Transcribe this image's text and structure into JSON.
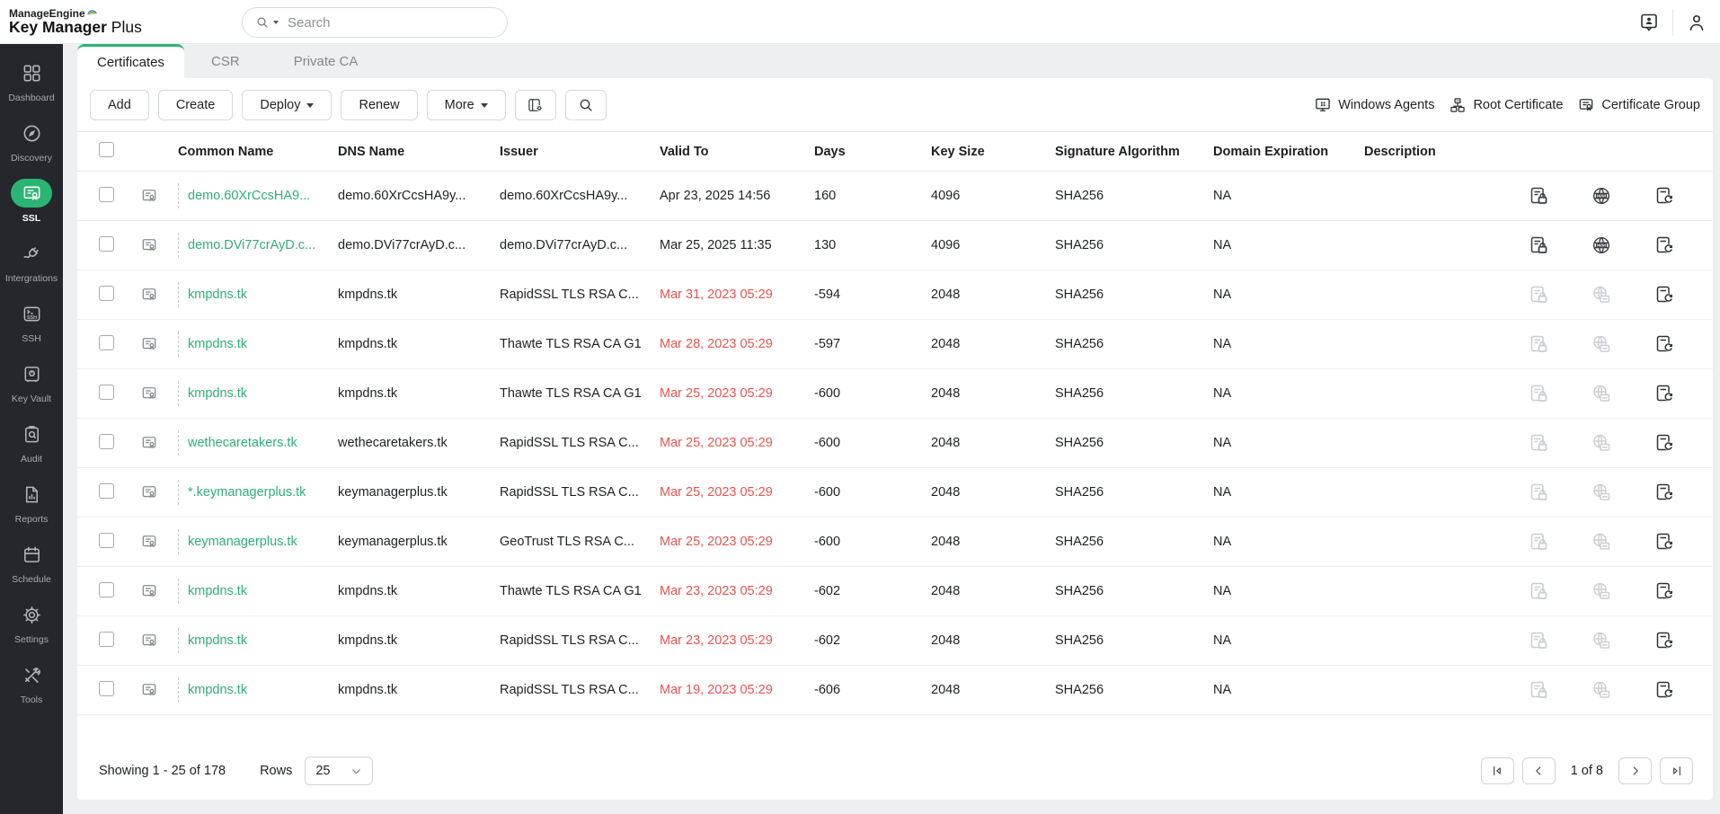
{
  "brand": {
    "company": "ManageEngine",
    "product_bold": "Key Manager",
    "product_light": " Plus"
  },
  "header": {
    "search_placeholder": "Search"
  },
  "sidebar": {
    "items": [
      {
        "label": "Dashboard"
      },
      {
        "label": "Discovery"
      },
      {
        "label": "SSL",
        "active": true
      },
      {
        "label": "Intergrations"
      },
      {
        "label": "SSH"
      },
      {
        "label": "Key Vault"
      },
      {
        "label": "Audit"
      },
      {
        "label": "Reports"
      },
      {
        "label": "Schedule"
      },
      {
        "label": "Settings"
      },
      {
        "label": "Tools"
      }
    ]
  },
  "tabs": [
    {
      "label": "Certificates",
      "active": true
    },
    {
      "label": "CSR"
    },
    {
      "label": "Private CA"
    }
  ],
  "toolbar": {
    "add": "Add",
    "create": "Create",
    "deploy": "Deploy",
    "renew": "Renew",
    "more": "More",
    "right": [
      {
        "label": "Windows Agents"
      },
      {
        "label": "Root Certificate"
      },
      {
        "label": "Certificate Group"
      }
    ]
  },
  "table": {
    "columns": [
      "Common Name",
      "DNS Name",
      "Issuer",
      "Valid To",
      "Days",
      "Key Size",
      "Signature Algorithm",
      "Domain Expiration",
      "Description"
    ],
    "rows": [
      {
        "common": "demo.60XrCcsHA9...",
        "dns": "demo.60XrCcsHA9y...",
        "issuer": "demo.60XrCcsHA9y...",
        "valid_to": "Apr 23, 2025 14:56",
        "days": "160",
        "key_size": "4096",
        "signature_algorithm": "SHA256",
        "domain_expiration": "NA",
        "description": "",
        "expired": false,
        "managed": true
      },
      {
        "common": "demo.DVi77crAyD.c...",
        "dns": "demo.DVi77crAyD.c...",
        "issuer": "demo.DVi77crAyD.c...",
        "valid_to": "Mar 25, 2025 11:35",
        "days": "130",
        "key_size": "4096",
        "signature_algorithm": "SHA256",
        "domain_expiration": "NA",
        "description": "",
        "expired": false,
        "managed": true
      },
      {
        "common": "kmpdns.tk",
        "dns": "kmpdns.tk",
        "issuer": "RapidSSL TLS RSA C...",
        "valid_to": "Mar 31, 2023 05:29",
        "days": "-594",
        "key_size": "2048",
        "signature_algorithm": "SHA256",
        "domain_expiration": "NA",
        "description": "",
        "expired": true,
        "managed": false
      },
      {
        "common": "kmpdns.tk",
        "dns": "kmpdns.tk",
        "issuer": "Thawte TLS RSA CA G1",
        "valid_to": "Mar 28, 2023 05:29",
        "days": "-597",
        "key_size": "2048",
        "signature_algorithm": "SHA256",
        "domain_expiration": "NA",
        "description": "",
        "expired": true,
        "managed": false
      },
      {
        "common": "kmpdns.tk",
        "dns": "kmpdns.tk",
        "issuer": "Thawte TLS RSA CA G1",
        "valid_to": "Mar 25, 2023 05:29",
        "days": "-600",
        "key_size": "2048",
        "signature_algorithm": "SHA256",
        "domain_expiration": "NA",
        "description": "",
        "expired": true,
        "managed": false
      },
      {
        "common": "wethecaretakers.tk",
        "dns": "wethecaretakers.tk",
        "issuer": "RapidSSL TLS RSA C...",
        "valid_to": "Mar 25, 2023 05:29",
        "days": "-600",
        "key_size": "2048",
        "signature_algorithm": "SHA256",
        "domain_expiration": "NA",
        "description": "",
        "expired": true,
        "managed": false
      },
      {
        "common": "*.keymanagerplus.tk",
        "dns": "keymanagerplus.tk",
        "issuer": "RapidSSL TLS RSA C...",
        "valid_to": "Mar 25, 2023 05:29",
        "days": "-600",
        "key_size": "2048",
        "signature_algorithm": "SHA256",
        "domain_expiration": "NA",
        "description": "",
        "expired": true,
        "managed": false
      },
      {
        "common": "keymanagerplus.tk",
        "dns": "keymanagerplus.tk",
        "issuer": "GeoTrust TLS RSA C...",
        "valid_to": "Mar 25, 2023 05:29",
        "days": "-600",
        "key_size": "2048",
        "signature_algorithm": "SHA256",
        "domain_expiration": "NA",
        "description": "",
        "expired": true,
        "managed": false
      },
      {
        "common": "kmpdns.tk",
        "dns": "kmpdns.tk",
        "issuer": "Thawte TLS RSA CA G1",
        "valid_to": "Mar 23, 2023 05:29",
        "days": "-602",
        "key_size": "2048",
        "signature_algorithm": "SHA256",
        "domain_expiration": "NA",
        "description": "",
        "expired": true,
        "managed": false
      },
      {
        "common": "kmpdns.tk",
        "dns": "kmpdns.tk",
        "issuer": "RapidSSL TLS RSA C...",
        "valid_to": "Mar 23, 2023 05:29",
        "days": "-602",
        "key_size": "2048",
        "signature_algorithm": "SHA256",
        "domain_expiration": "NA",
        "description": "",
        "expired": true,
        "managed": false
      },
      {
        "common": "kmpdns.tk",
        "dns": "kmpdns.tk",
        "issuer": "RapidSSL TLS RSA C...",
        "valid_to": "Mar 19, 2023 05:29",
        "days": "-606",
        "key_size": "2048",
        "signature_algorithm": "SHA256",
        "domain_expiration": "NA",
        "description": "",
        "expired": true,
        "managed": false
      }
    ]
  },
  "footer": {
    "showing": "Showing 1 - 25 of 178",
    "rows_label": "Rows",
    "rows_value": "25",
    "page": "1 of 8"
  },
  "colors": {
    "accent_green": "#2bb573",
    "link_green": "#2fae78",
    "expired_red": "#e8534e",
    "sidebar_bg": "#25272c"
  }
}
